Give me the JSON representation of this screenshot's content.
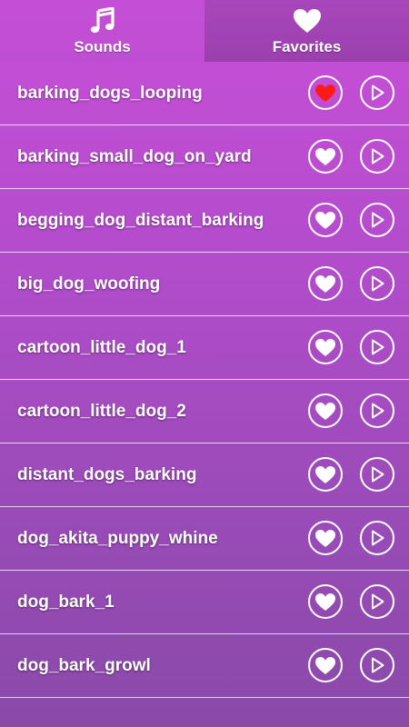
{
  "tabs": [
    {
      "label": "Sounds",
      "icon": "music-note-icon",
      "active": true
    },
    {
      "label": "Favorites",
      "icon": "heart-icon",
      "active": false
    }
  ],
  "colors": {
    "favorite_active": "#ff1a1a",
    "icon_white": "#ffffff"
  },
  "sounds": [
    {
      "name": "barking_dogs_looping",
      "favorite": true
    },
    {
      "name": "barking_small_dog_on_yard",
      "favorite": false
    },
    {
      "name": "begging_dog_distant_barking",
      "favorite": false
    },
    {
      "name": "big_dog_woofing",
      "favorite": false
    },
    {
      "name": "cartoon_little_dog_1",
      "favorite": false
    },
    {
      "name": "cartoon_little_dog_2",
      "favorite": false
    },
    {
      "name": "distant_dogs_barking",
      "favorite": false
    },
    {
      "name": "dog_akita_puppy_whine",
      "favorite": false
    },
    {
      "name": "dog_bark_1",
      "favorite": false
    },
    {
      "name": "dog_bark_growl",
      "favorite": false
    }
  ]
}
